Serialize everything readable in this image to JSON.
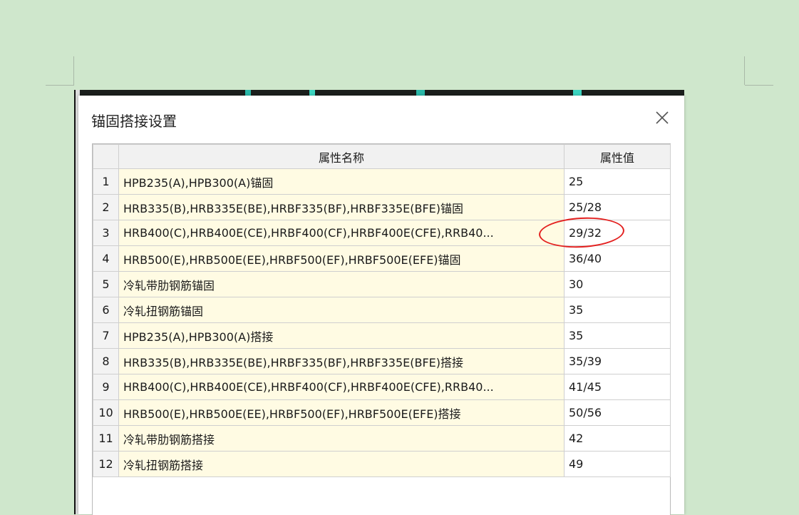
{
  "dialog": {
    "title": "锚固搭接设置",
    "close_icon": "close-icon"
  },
  "table": {
    "columns": [
      "",
      "属性名称",
      "属性值"
    ],
    "rows": [
      {
        "index": "1",
        "name": "HPB235(A),HPB300(A)锚固",
        "value": "25"
      },
      {
        "index": "2",
        "name": "HRB335(B),HRB335E(BE),HRBF335(BF),HRBF335E(BFE)锚固",
        "value": "25/28"
      },
      {
        "index": "3",
        "name": "HRB400(C),HRB400E(CE),HRBF400(CF),HRBF400E(CFE),RRB40...",
        "value": "29/32"
      },
      {
        "index": "4",
        "name": "HRB500(E),HRB500E(EE),HRBF500(EF),HRBF500E(EFE)锚固",
        "value": "36/40"
      },
      {
        "index": "5",
        "name": "冷轧带肋钢筋锚固",
        "value": "30"
      },
      {
        "index": "6",
        "name": "冷轧扭钢筋锚固",
        "value": "35"
      },
      {
        "index": "7",
        "name": "HPB235(A),HPB300(A)搭接",
        "value": "35"
      },
      {
        "index": "8",
        "name": "HRB335(B),HRB335E(BE),HRBF335(BF),HRBF335E(BFE)搭接",
        "value": "35/39"
      },
      {
        "index": "9",
        "name": "HRB400(C),HRB400E(CE),HRBF400(CF),HRBF400E(CFE),RRB40...",
        "value": "41/45"
      },
      {
        "index": "10",
        "name": "HRB500(E),HRB500E(EE),HRBF500(EF),HRBF500E(EFE)搭接",
        "value": "50/56"
      },
      {
        "index": "11",
        "name": "冷轧带肋钢筋搭接",
        "value": "42"
      },
      {
        "index": "12",
        "name": "冷轧扭钢筋搭接",
        "value": "49"
      }
    ]
  },
  "colors": {
    "background": "#cfe7cc",
    "name_cell": "#fffbe3",
    "annotation": "#e3201f"
  }
}
